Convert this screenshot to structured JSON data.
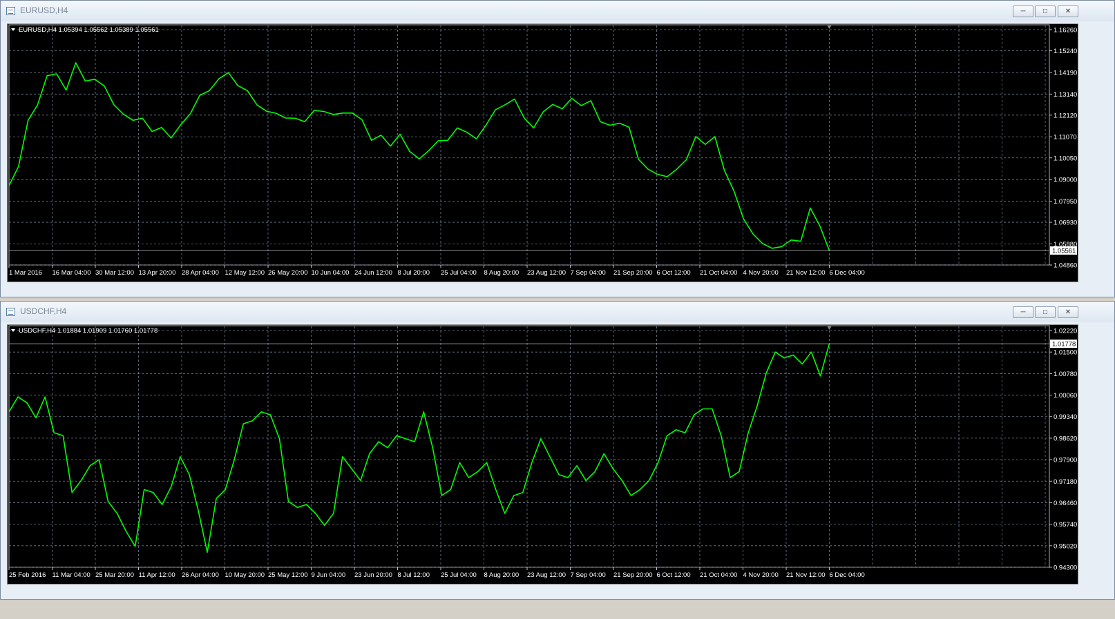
{
  "windows": [
    {
      "title": "EURUSD,H4",
      "info": "EURUSD,H4  1.05394 1.05562 1.05389 1.05561",
      "price_tag": "1.05561",
      "price_tag_value": 1.05561,
      "y_labels": [
        "1.16260",
        "1.15240",
        "1.14190",
        "1.13140",
        "1.12120",
        "1.11070",
        "1.10050",
        "1.09000",
        "1.07950",
        "1.06930",
        "1.05880",
        "1.04860"
      ],
      "x_labels": [
        "1 Mar 2016",
        "16 Mar 04:00",
        "30 Mar 12:00",
        "13 Apr 20:00",
        "28 Apr 04:00",
        "12 May 12:00",
        "26 May 20:00",
        "10 Jun 04:00",
        "24 Jun 12:00",
        "8 Jul 20:00",
        "25 Jul 04:00",
        "8 Aug 20:00",
        "23 Aug 12:00",
        "7 Sep 04:00",
        "21 Sep 20:00",
        "6 Oct 12:00",
        "21 Oct 04:00",
        "4 Nov 20:00",
        "21 Nov 12:00",
        "6 Dec 04:00"
      ]
    },
    {
      "title": "USDCHF,H4",
      "info": "USDCHF,H4  1.01884 1.01909 1.01760 1.01778",
      "price_tag": "1.01778",
      "price_tag_value": 1.01778,
      "y_labels": [
        "1.02220",
        "1.01500",
        "1.00780",
        "1.00060",
        "0.99340",
        "0.98620",
        "0.97900",
        "0.97180",
        "0.96460",
        "0.95740",
        "0.95020",
        "0.94300"
      ],
      "x_labels": [
        "25 Feb 2016",
        "11 Mar 04:00",
        "25 Mar 20:00",
        "11 Apr 12:00",
        "26 Apr 04:00",
        "10 May 20:00",
        "25 May 12:00",
        "9 Jun 04:00",
        "23 Jun 20:00",
        "8 Jul 12:00",
        "25 Jul 04:00",
        "8 Aug 20:00",
        "23 Aug 12:00",
        "7 Sep 04:00",
        "21 Sep 20:00",
        "6 Oct 12:00",
        "21 Oct 04:00",
        "4 Nov 20:00",
        "21 Nov 12:00",
        "6 Dec 04:00"
      ]
    }
  ],
  "chart_data": [
    {
      "type": "line",
      "symbol": "EURUSD",
      "timeframe": "H4",
      "ylim": [
        1.0486,
        1.1626
      ],
      "colors": {
        "line": "#00ff00",
        "grid": "#708090",
        "background": "#000000"
      },
      "x": [
        "1 Mar 2016",
        "16 Mar 04:00",
        "30 Mar 12:00",
        "13 Apr 20:00",
        "28 Apr 04:00",
        "12 May 12:00",
        "26 May 20:00",
        "10 Jun 04:00",
        "24 Jun 12:00",
        "8 Jul 20:00",
        "25 Jul 04:00",
        "8 Aug 20:00",
        "23 Aug 12:00",
        "7 Sep 04:00",
        "21 Sep 20:00",
        "6 Oct 12:00",
        "21 Oct 04:00",
        "4 Nov 20:00",
        "21 Nov 12:00",
        "6 Dec 04:00"
      ],
      "series": [
        {
          "values": [
            1.087,
            1.0963,
            1.1186,
            1.1262,
            1.1403,
            1.1412,
            1.1333,
            1.1466,
            1.1377,
            1.1386,
            1.1353,
            1.1262,
            1.1216,
            1.1187,
            1.1197,
            1.1133,
            1.1152,
            1.1101,
            1.1165,
            1.1218,
            1.1308,
            1.133,
            1.1388,
            1.1418,
            1.1355,
            1.133,
            1.1262,
            1.1231,
            1.1221,
            1.1198,
            1.1197,
            1.118,
            1.1235,
            1.123,
            1.1215,
            1.1222,
            1.1222,
            1.119,
            1.109,
            1.1115,
            1.1062,
            1.112,
            1.1037,
            1.1,
            1.104,
            1.1088,
            1.109,
            1.115,
            1.1129,
            1.1097,
            1.1163,
            1.1238,
            1.1262,
            1.129,
            1.1199,
            1.115,
            1.1228,
            1.1264,
            1.1243,
            1.1293,
            1.1258,
            1.1282,
            1.118,
            1.1163,
            1.1173,
            1.1154,
            1.0998,
            1.095,
            1.0925,
            1.0914,
            1.095,
            1.0995,
            1.1108,
            1.107,
            1.1108,
            1.0944,
            1.0845,
            1.071,
            1.0636,
            1.059,
            1.0567,
            1.0575,
            1.0607,
            1.0601,
            1.0762,
            1.0676,
            1.0556
          ]
        }
      ]
    },
    {
      "type": "line",
      "symbol": "USDCHF",
      "timeframe": "H4",
      "ylim": [
        0.943,
        1.0222
      ],
      "colors": {
        "line": "#00ff00",
        "grid": "#708090",
        "background": "#000000"
      },
      "x": [
        "25 Feb 2016",
        "11 Mar 04:00",
        "25 Mar 20:00",
        "11 Apr 12:00",
        "26 Apr 04:00",
        "10 May 20:00",
        "25 May 12:00",
        "9 Jun 04:00",
        "23 Jun 20:00",
        "8 Jul 12:00",
        "25 Jul 04:00",
        "8 Aug 20:00",
        "23 Aug 12:00",
        "7 Sep 04:00",
        "21 Sep 20:00",
        "6 Oct 12:00",
        "21 Oct 04:00",
        "4 Nov 20:00",
        "21 Nov 12:00",
        "6 Dec 04:00"
      ],
      "series": [
        {
          "values": [
            0.995,
            1.0,
            0.998,
            0.993,
            1.0,
            0.988,
            0.987,
            0.968,
            0.972,
            0.977,
            0.979,
            0.965,
            0.961,
            0.955,
            0.95,
            0.969,
            0.968,
            0.964,
            0.97,
            0.98,
            0.974,
            0.962,
            0.948,
            0.966,
            0.969,
            0.979,
            0.991,
            0.992,
            0.995,
            0.994,
            0.986,
            0.965,
            0.963,
            0.964,
            0.961,
            0.957,
            0.961,
            0.98,
            0.976,
            0.972,
            0.981,
            0.985,
            0.983,
            0.987,
            0.986,
            0.985,
            0.995,
            0.983,
            0.967,
            0.969,
            0.978,
            0.973,
            0.975,
            0.978,
            0.969,
            0.961,
            0.967,
            0.968,
            0.978,
            0.986,
            0.98,
            0.974,
            0.973,
            0.977,
            0.972,
            0.975,
            0.981,
            0.976,
            0.972,
            0.967,
            0.969,
            0.972,
            0.978,
            0.987,
            0.989,
            0.988,
            0.994,
            0.996,
            0.996,
            0.987,
            0.973,
            0.975,
            0.988,
            0.997,
            1.008,
            1.015,
            1.013,
            1.014,
            1.011,
            1.015,
            1.007,
            1.0178
          ]
        }
      ]
    }
  ]
}
